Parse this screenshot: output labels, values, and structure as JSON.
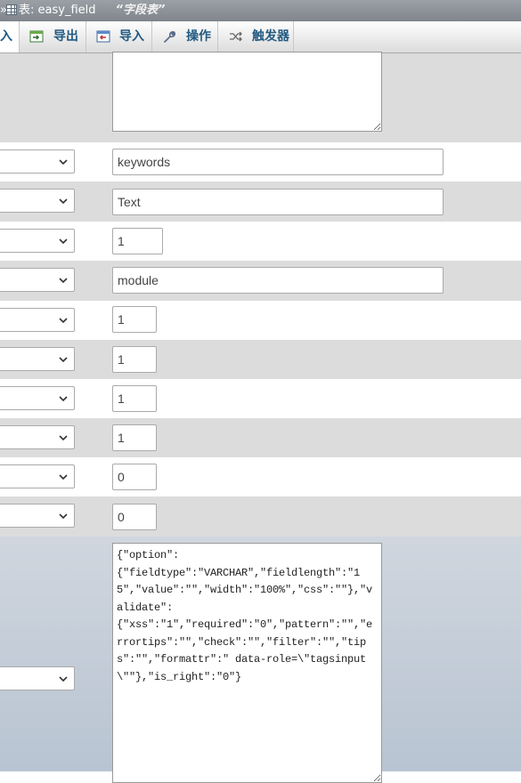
{
  "header": {
    "breadcrumb_sep": "»",
    "table_label": "表:",
    "table_name": "easy_field",
    "table_comment": "“字段表”"
  },
  "tabs": [
    {
      "label": "入",
      "icon": "insert-icon"
    },
    {
      "label": "导出",
      "icon": "export-icon"
    },
    {
      "label": "导入",
      "icon": "import-icon"
    },
    {
      "label": "操作",
      "icon": "wrench-icon"
    },
    {
      "label": "触发器",
      "icon": "trigger-icon"
    }
  ],
  "fields": [
    {
      "value": "keywords"
    },
    {
      "value": "Text"
    },
    {
      "value": "1"
    },
    {
      "value": "module"
    },
    {
      "value": "1"
    },
    {
      "value": "1"
    },
    {
      "value": "1"
    },
    {
      "value": "1"
    },
    {
      "value": "0"
    },
    {
      "value": "0"
    }
  ],
  "json_field": {
    "value": "{\"option\":\n{\"fieldtype\":\"VARCHAR\",\"fieldlength\":\"15\",\"value\":\"\",\"width\":\"100%\",\"css\":\"\"},\"validate\":\n{\"xss\":\"1\",\"required\":\"0\",\"pattern\":\"\",\"errortips\":\"\",\"check\":\"\",\"filter\":\"\",\"tips\":\"\",\"formattr\":\" data-role=\\\"tagsinput\\\"\"},\"is_right\":\"0\"}"
  },
  "colors": {
    "tab_text": "#235a81",
    "row_alt": "#dcdcdc",
    "json_row": "#c4cdd8"
  }
}
